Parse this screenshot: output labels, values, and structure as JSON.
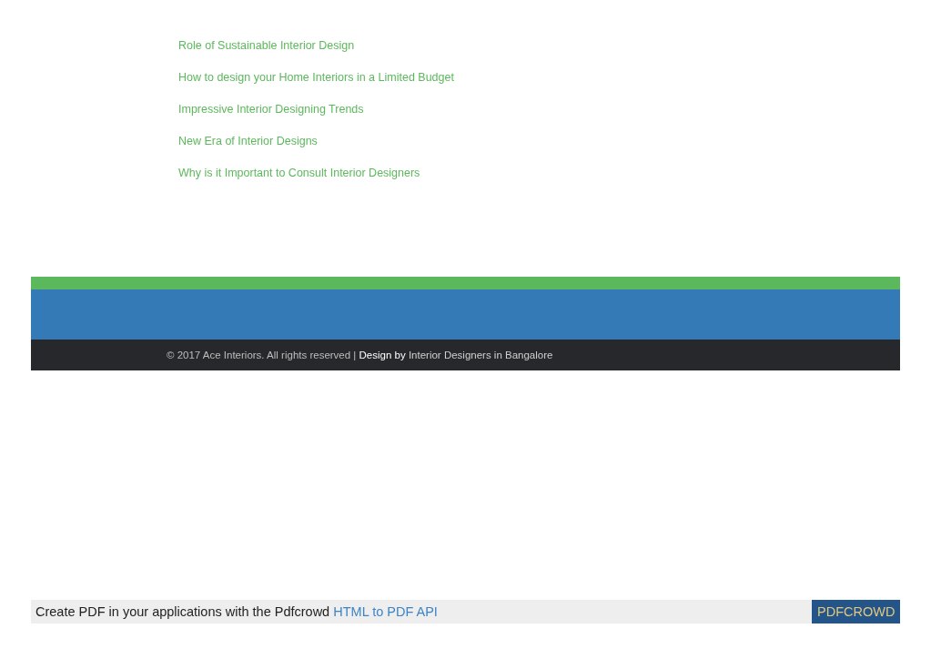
{
  "article_links": [
    "Role of Sustainable Interior Design",
    "How to design your Home Interiors in a Limited Budget",
    "Impressive Interior Designing Trends",
    "New Era of Interior Designs",
    "Why is it Important to Consult Interior Designers"
  ],
  "footer": {
    "text": "© 2017 Ace Interiors. All rights reserved | **Design by**",
    "link": "Interior Designers in Bangalore"
  },
  "pdf_bar": {
    "text": "Create PDF in your applications with the Pdfcrowd",
    "link": "HTML to PDF API",
    "button": "PDFCROWD"
  }
}
